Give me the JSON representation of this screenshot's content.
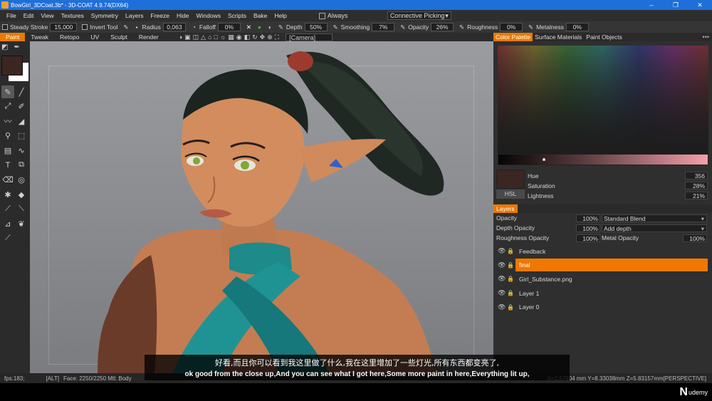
{
  "window": {
    "title": "BowGirl_3DCoat.3b* - 3D-COAT 4.9.74(DX64)",
    "controls": [
      "–",
      "❐",
      "✕"
    ]
  },
  "menu": {
    "items": [
      "File",
      "Edit",
      "View",
      "Textures",
      "Symmetry",
      "Layers",
      "Freeze",
      "Hide",
      "Windows",
      "Scripts",
      "Bake",
      "Help"
    ],
    "always_label": "Always",
    "picking_label": "Connective Picking"
  },
  "tool_options": {
    "steady_stroke": "Steady Stroke",
    "steady_value": "15,000",
    "invert_tool": "Invert Tool",
    "radius_label": "Radius",
    "radius_value": "0,063",
    "falloff_label": "Falloff",
    "falloff_value": "0%",
    "depth_label": "Depth",
    "depth_value": "50%",
    "smoothing_label": "Smoothing",
    "smoothing_value": "7%",
    "opacity_label": "Opacity",
    "opacity_value": "26%",
    "roughness_label": "Roughness",
    "roughness_value": "0%",
    "metalness_label": "Metalness",
    "metalness_value": "0%"
  },
  "rooms": {
    "items": [
      "Paint",
      "Tweak",
      "Retopo",
      "UV",
      "Sculpt",
      "Render"
    ],
    "active": "Paint",
    "camera": "[Camera]"
  },
  "right_panel": {
    "tabs": [
      "Color Palette",
      "Surface Materials",
      "Paint Objects"
    ],
    "active_tab": "Color Palette",
    "hue_label": "Hue",
    "hue_value": "356",
    "saturation_label": "Saturation",
    "saturation_value": "28%",
    "lightness_label": "Lightness",
    "lightness_value": "21%",
    "hsl_button": "HSL",
    "current_color": "#3b2622"
  },
  "layers": {
    "title": "Layers",
    "opacity_label": "Opacity",
    "opacity_value": "100%",
    "blend_mode": "Standard Blend",
    "depth_opacity_label": "Depth Opacity",
    "depth_opacity_value": "100%",
    "depth_mode": "Add depth",
    "roughness_opacity_label": "Roughness Opacity",
    "roughness_opacity_value": "100%",
    "metal_opacity_label": "Metal Opacity",
    "metal_opacity_value": "100%",
    "items": [
      {
        "name": "Feedback",
        "selected": false
      },
      {
        "name": "final",
        "selected": true
      },
      {
        "name": "Girl_Substance.png",
        "selected": false
      },
      {
        "name": "Layer 1",
        "selected": false
      },
      {
        "name": "Layer 0",
        "selected": false
      }
    ]
  },
  "status": {
    "fps": "fps:183;",
    "alt": "[ALT]",
    "face": "Face: 2250/2250 Mtl: Body",
    "coords": "X=1.57604 mm  Y=8.33038mm  Z=5.83157mm[PERSPECTIVE]"
  },
  "subtitles": {
    "zh": "好看,而且你可以看到我这里做了什么,我在这里增加了一些灯光,所有东西都变亮了,",
    "en": "ok good from the close up,And you can see what I got here,Some more paint in here,Everything lit up,"
  },
  "watermark": "udemy"
}
